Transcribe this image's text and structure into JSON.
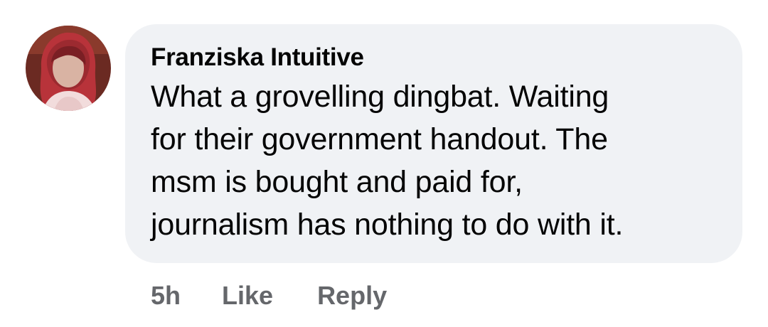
{
  "comment": {
    "author": "Franziska Intuitive",
    "text": "What a grovelling dingbat. Waiting\nfor their government handout. The\nmsm is bought and paid for,\njournalism has nothing to do with it.",
    "avatar_icon": "profile-photo",
    "timestamp": "5h",
    "like_label": "Like",
    "reply_label": "Reply"
  },
  "colors": {
    "bubble_background": "#f0f2f5",
    "text_primary": "#050505",
    "text_secondary": "#65676b"
  }
}
